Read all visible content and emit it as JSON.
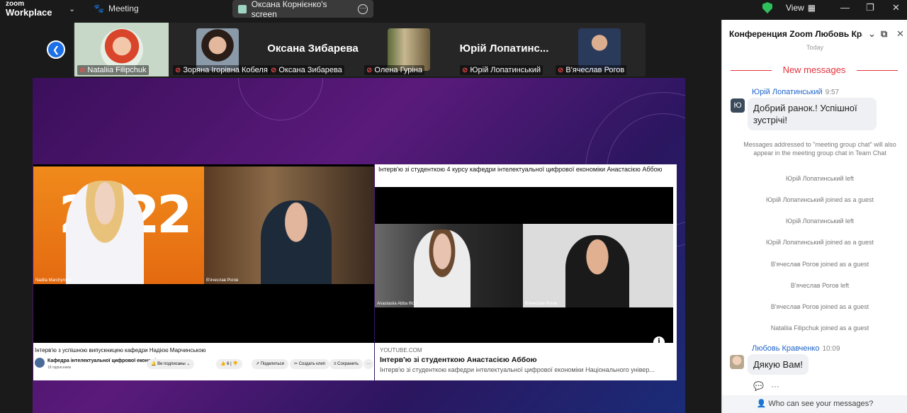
{
  "topbar": {
    "brand_line1": "zoom",
    "brand_line2": "Workplace",
    "meeting_label": "Meeting",
    "screen_share_label": "Оксана Корнієнко's screen",
    "view_label": "View"
  },
  "participants": [
    {
      "name": "Nataliia Filipchuk",
      "display": "video"
    },
    {
      "name": "Зоряна Ігорівна Кобеля",
      "display": "video"
    },
    {
      "name": "Оксана Зибарева",
      "display": "name",
      "big_name": "Оксана Зибарева"
    },
    {
      "name": "Олена Гуріна",
      "display": "video"
    },
    {
      "name": "Юрій Лопатинський",
      "display": "name",
      "big_name": "Юрій Лопатинс..."
    },
    {
      "name": "В'ячеслав Рогов",
      "display": "video"
    }
  ],
  "shared_screen": {
    "left_video": {
      "year_text": "2022",
      "tag_left": "Nadiia Marchynska",
      "tag_right": "В'ячеслав Рогов",
      "title": "Інтерв'ю з успішною випускницею кафедри Надією Марчинською",
      "channel": "Кафедра інтелектуальної цифрової економіки",
      "subscribers": "18 підписників",
      "subscribed_label": "Ви подписаны",
      "likes": "6",
      "share_label": "Поделиться",
      "clip_label": "Создать клип",
      "save_label": "Сохранить"
    },
    "right_video": {
      "title": "Інтерв'ю зі студенткою 4 курсу кафедри інтелектуальної цифрової економіки Анастасією Аббою",
      "tag_left": "Anastasiia Abba  IN17",
      "tag_right": "В'ячеслав Рогов",
      "source": "YOUTUBE.COM",
      "card_title": "Інтерв'ю зі студенткою Анастасією Аббою",
      "card_desc": "Інтерв'ю зі студенткою кафедри інтелектуальної цифрової економіки Національного універ..."
    }
  },
  "chat": {
    "title": "Конференция Zoom Любовь Кра...",
    "today": "Today",
    "new_messages": "New messages",
    "msg1": {
      "avatar": "Ю",
      "sender": "Юрій Лопатинський",
      "time": "9:57",
      "text_line1": "Добрий ранок.! Успішної",
      "text_line2": "зустрічі!"
    },
    "system": [
      "Messages addressed to \"meeting group chat\" will also appear in the meeting group chat in Team Chat",
      "Юрій Лопатинський left",
      "Юрій Лопатинський joined as a guest",
      "Юрій Лопатинський left",
      "Юрій Лопатинський joined as a guest",
      "В'ячеслав Рогов joined as a guest",
      "В'ячеслав Рогов left",
      "В'ячеслав Рогов joined as a guest",
      "Nataliia Filipchuk joined as a guest"
    ],
    "msg2": {
      "sender": "Любовь Кравченко",
      "time": "10:09",
      "text": "Дякую  Вам!"
    },
    "who_can_see": "Who can see your messages?"
  },
  "colors": {
    "accent": "#1d6fe6",
    "new_messages": "#e0323c",
    "shield": "#2ec05a"
  }
}
